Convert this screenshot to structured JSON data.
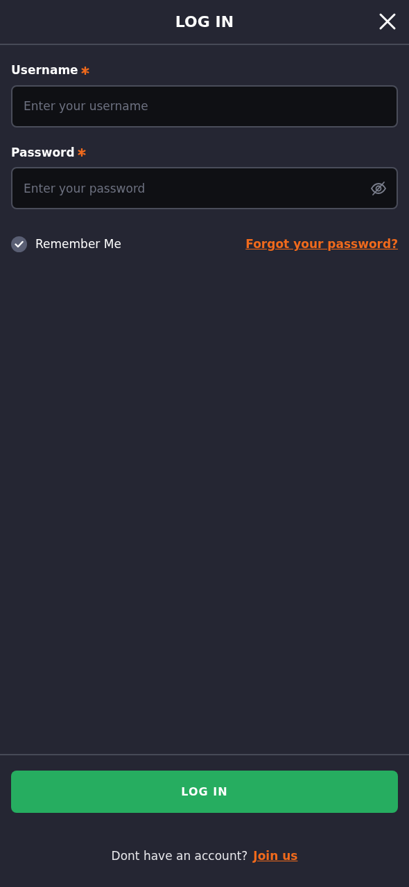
{
  "header": {
    "title": "LOG IN"
  },
  "fields": [
    {
      "label": "Username",
      "required": true,
      "placeholder": "Enter your username",
      "kind": "text"
    },
    {
      "label": "Password",
      "required": true,
      "placeholder": "Enter your password",
      "kind": "password"
    }
  ],
  "remember": {
    "label": "Remember Me",
    "checked": true
  },
  "forgot_link": "Forgot your password?",
  "login_button": "LOG IN",
  "footer": {
    "text": "Dont have an account?",
    "link": "Join us"
  }
}
